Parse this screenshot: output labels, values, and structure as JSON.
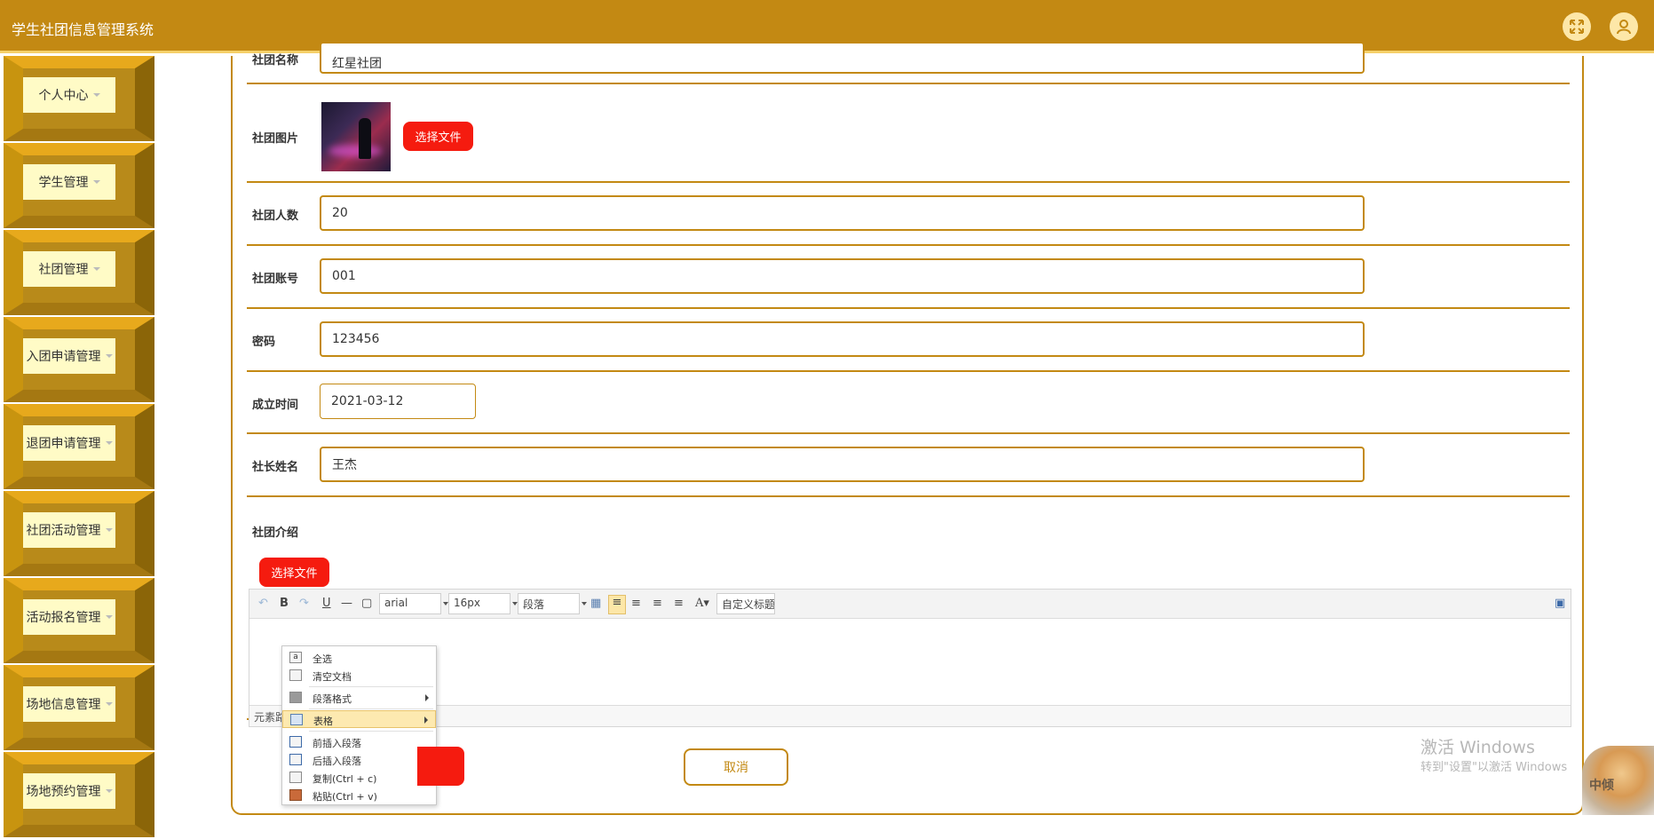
{
  "app": {
    "title": "学生社团信息管理系统"
  },
  "header": {
    "fullscreen_icon": "expand-icon",
    "user_icon": "user-icon"
  },
  "sidebar": {
    "items": [
      {
        "label": "个人中心"
      },
      {
        "label": "学生管理"
      },
      {
        "label": "社团管理"
      },
      {
        "label": "入团申请管理"
      },
      {
        "label": "退团申请管理"
      },
      {
        "label": "社团活动管理"
      },
      {
        "label": "活动报名管理"
      },
      {
        "label": "场地信息管理"
      },
      {
        "label": "场地预约管理"
      }
    ]
  },
  "form": {
    "club_name": {
      "label": "社团名称",
      "value": "红星社团"
    },
    "club_image": {
      "label": "社团图片",
      "button": "选择文件"
    },
    "member_count": {
      "label": "社团人数",
      "value": "20"
    },
    "account": {
      "label": "社团账号",
      "value": "001"
    },
    "password": {
      "label": "密码",
      "value": "123456"
    },
    "founded": {
      "label": "成立时间",
      "value": "2021-03-12"
    },
    "leader": {
      "label": "社长姓名",
      "value": "王杰"
    },
    "intro": {
      "label": "社团介绍",
      "button": "选择文件"
    },
    "cancel": "取消"
  },
  "editor": {
    "font_family": "arial",
    "font_size": "16px",
    "paragraph": "段落",
    "custom_title": "自定义标题",
    "status_text": "元素路"
  },
  "context_menu": {
    "items": [
      {
        "label": "全选",
        "icon": "select-all-icon"
      },
      {
        "label": "清空文档",
        "icon": "clear-doc-icon"
      },
      {
        "label": "段落格式",
        "icon": "paragraph-icon"
      },
      {
        "label": "表格",
        "icon": "table-icon"
      },
      {
        "label": "前插入段落",
        "icon": "insert-before-icon"
      },
      {
        "label": "后插入段落",
        "icon": "insert-after-icon"
      },
      {
        "label": "复制(Ctrl + c)",
        "icon": "copy-icon"
      },
      {
        "label": "粘贴(Ctrl + v)",
        "icon": "paste-icon"
      }
    ]
  },
  "watermark": {
    "line1": "激活 Windows",
    "line2": "转到\"设置\"以激活 Windows"
  },
  "pet_text": "中倾"
}
